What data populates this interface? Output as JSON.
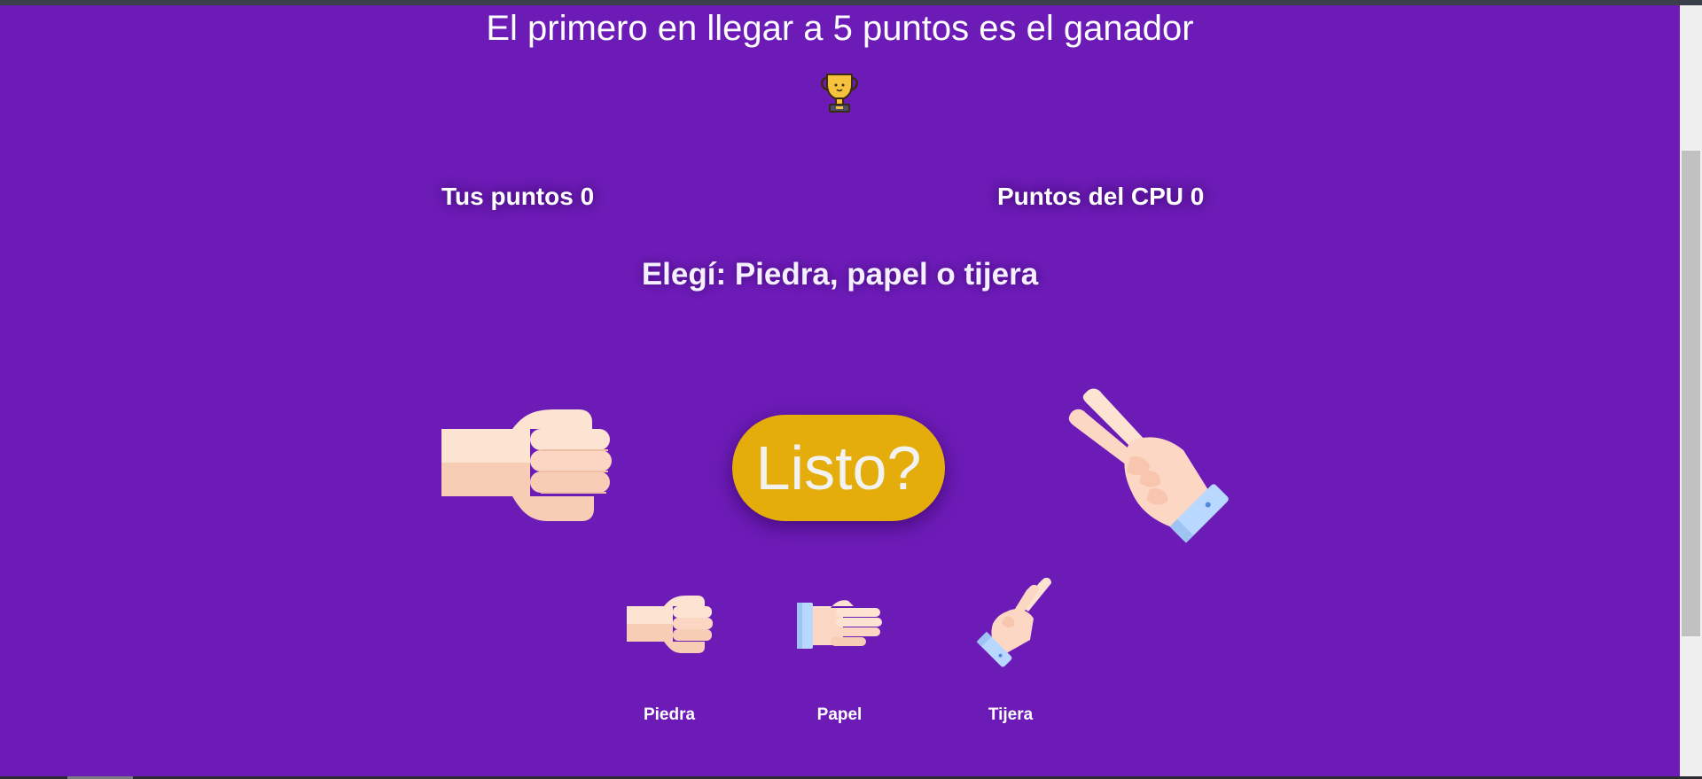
{
  "game": {
    "title": "El primero en llegar a 5 puntos es el ganador",
    "trophy_icon": "trophy-icon"
  },
  "scores": {
    "user_label": "Tus puntos 0",
    "cpu_label": "Puntos del CPU 0"
  },
  "prompt": "Elegí: Piedra, papel o tijera",
  "ready_button": {
    "label": "Listo?",
    "color": "#e5ad0c"
  },
  "hands": {
    "player_icon": "fist-hand-icon",
    "cpu_icon": "scissors-hand-icon"
  },
  "choices": [
    {
      "label": "Piedra",
      "icon": "rock-hand-icon"
    },
    {
      "label": "Papel",
      "icon": "paper-hand-icon"
    },
    {
      "label": "Tijera",
      "icon": "scissors-hand-icon"
    }
  ],
  "colors": {
    "background": "#6d1bb7",
    "text": "#ffffff",
    "skin": "#fbd3bf",
    "cuff": "#b9d8ff"
  }
}
